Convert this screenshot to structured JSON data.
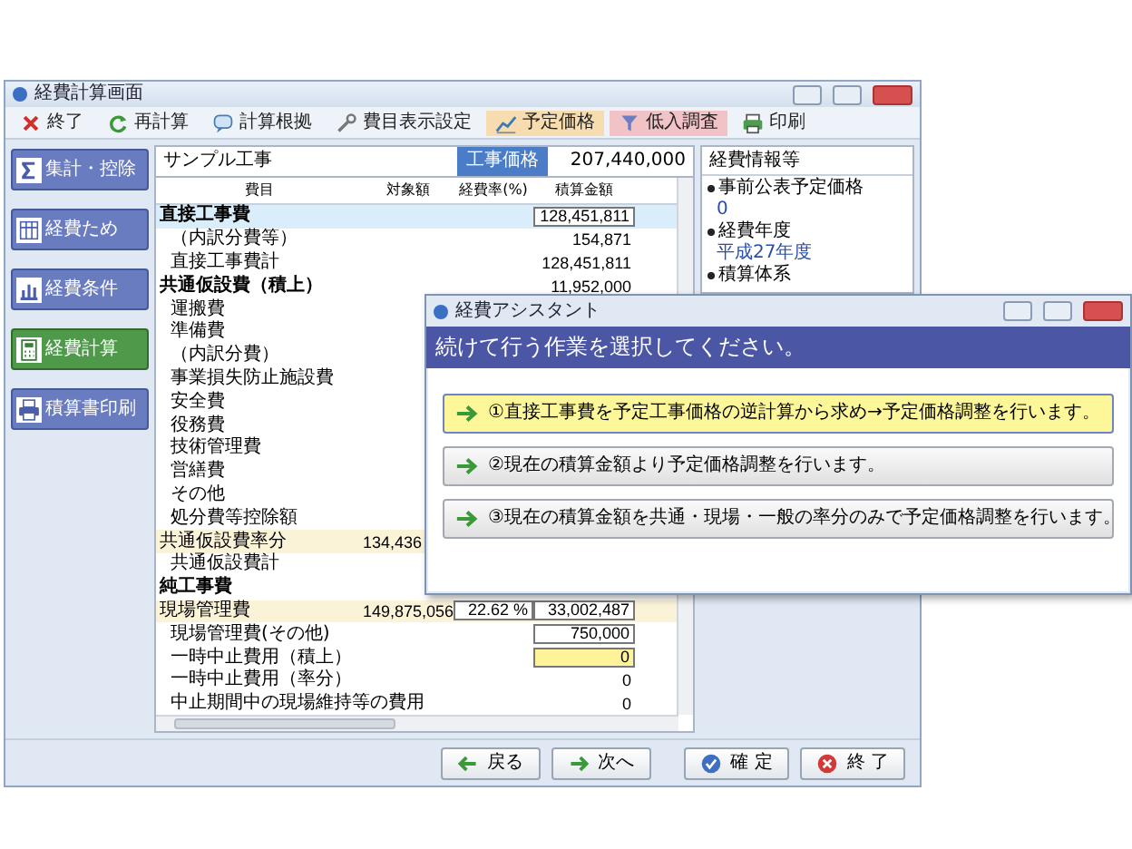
{
  "window": {
    "title": "経費計算画面"
  },
  "toolbar": [
    {
      "label": "終了"
    },
    {
      "label": "再計算"
    },
    {
      "label": "計算根拠"
    },
    {
      "label": "費目表示設定"
    },
    {
      "label": "予定価格",
      "color": "#f6dcae"
    },
    {
      "label": "低入調査",
      "color": "#f2c3c6"
    },
    {
      "label": "印刷"
    }
  ],
  "sidebar": {
    "items": [
      {
        "label": "集計・控除",
        "selected": false
      },
      {
        "label": "経費ため",
        "selected": false
      },
      {
        "label": "経費条件",
        "selected": false
      },
      {
        "label": "経費計算",
        "selected": true
      },
      {
        "label": "積算書印刷",
        "selected": false
      }
    ]
  },
  "project": {
    "name": "サンプル工事",
    "tab": "工事価格",
    "amount": "207,440,000"
  },
  "table": {
    "columns": [
      "費目",
      "対象額",
      "経費率(%)",
      "積算金額"
    ],
    "rows": [
      {
        "kind": "section",
        "label": "直接工事費",
        "amount": "128,451,811",
        "amount_field": true,
        "selected": true
      },
      {
        "kind": "item",
        "label": "（内訳分費等）",
        "amount": "154,871",
        "selected": false
      },
      {
        "kind": "item",
        "label": "直接工事費計",
        "amount": "128,451,811",
        "selected": false
      },
      {
        "kind": "section",
        "label": "共通仮設費（積上）",
        "amount": "11,952,000",
        "selected": false
      },
      {
        "kind": "item",
        "label": "運搬費",
        "selected": false
      },
      {
        "kind": "item",
        "label": "準備費",
        "selected": false
      },
      {
        "kind": "item",
        "label": "（内訳分費）",
        "selected": false
      },
      {
        "kind": "item",
        "label": "事業損失防止施設費",
        "selected": false
      },
      {
        "kind": "item",
        "label": "安全費",
        "selected": false
      },
      {
        "kind": "item",
        "label": "役務費",
        "selected": false
      },
      {
        "kind": "item",
        "label": "技術管理費",
        "selected": false
      },
      {
        "kind": "item",
        "label": "営繕費",
        "selected": false
      },
      {
        "kind": "item",
        "label": "その他",
        "selected": false
      },
      {
        "kind": "item",
        "label": "処分費等控除額",
        "selected": false
      },
      {
        "kind": "rate",
        "label": "共通仮設費率分",
        "target": "134,436",
        "selected": false
      },
      {
        "kind": "item",
        "label": "共通仮設費計",
        "selected": false
      },
      {
        "kind": "section",
        "label": "純工事費",
        "selected": false
      },
      {
        "kind": "rate",
        "label": "現場管理費",
        "target": "149,875,056",
        "rate": "22.62 %",
        "amount": "33,002,487",
        "amount_field": true,
        "selected": false
      },
      {
        "kind": "item",
        "label": "現場管理費(その他)",
        "amount": "750,000",
        "amount_field": true,
        "selected": false
      },
      {
        "kind": "item",
        "label": "一時中止費用（積上）",
        "amount": "0",
        "amount_field": true,
        "highlighted": true,
        "selected": false
      },
      {
        "kind": "item",
        "label": "一時中止費用（率分）",
        "amount": "0",
        "selected": false
      },
      {
        "kind": "item",
        "label": "中止期間中の現場維持等の費用",
        "amount": "0",
        "selected": false
      }
    ]
  },
  "info_panel": {
    "title": "経費情報等",
    "items": [
      {
        "label": "事前公表予定価格",
        "value": "0"
      },
      {
        "label": "経費年度",
        "value": "平成27年度"
      },
      {
        "label": "積算体系"
      }
    ]
  },
  "footer": {
    "buttons": [
      {
        "label": "戻る"
      },
      {
        "label": "次へ"
      },
      {
        "label": "確 定"
      },
      {
        "label": "終 了"
      }
    ]
  },
  "dialog": {
    "title": "経費アシスタント",
    "heading": "続けて行う作業を選択してください。",
    "options": [
      {
        "label": "①直接工事費を予定工事価格の逆計算から求め→予定価格調整を行います。",
        "selected": true
      },
      {
        "label": "②現在の積算金額より予定価格調整を行います。",
        "selected": false
      },
      {
        "label": "③現在の積算金額を共通・現場・一般の率分のみで予定価格調整を行います。",
        "selected": false
      }
    ]
  }
}
